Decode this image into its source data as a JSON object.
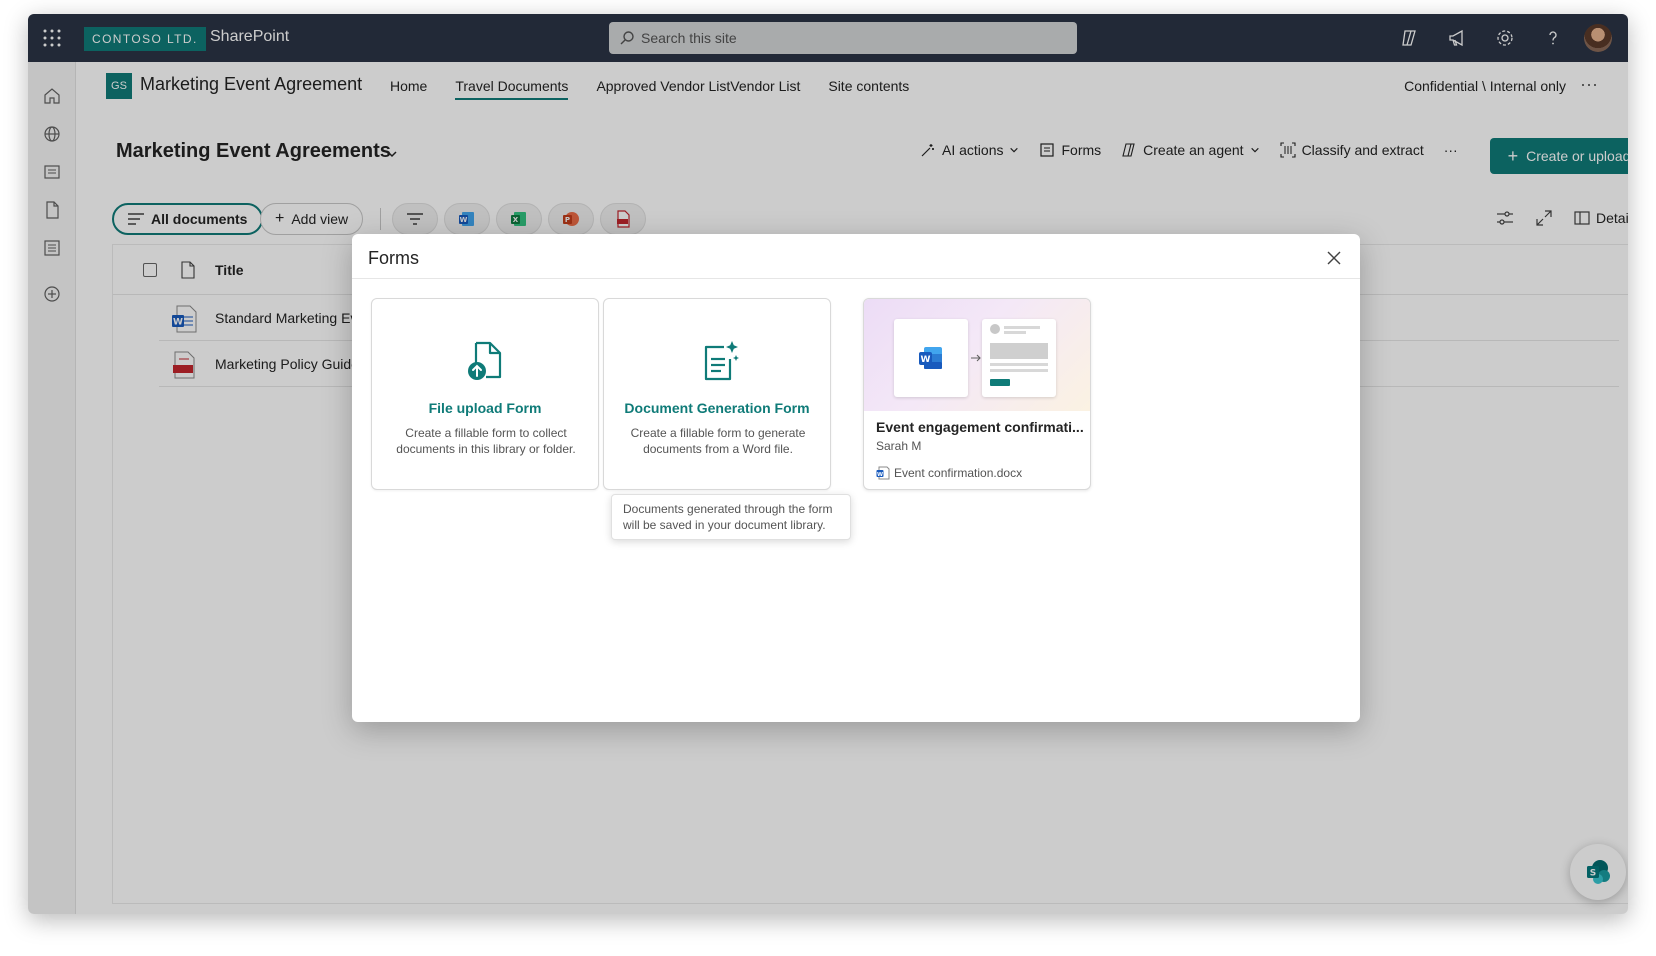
{
  "topbar": {
    "brand": "CONTOSO LTD.",
    "app": "SharePoint",
    "search_placeholder": "Search this site",
    "icons": [
      "waffle-icon",
      "copilot-icon",
      "megaphone-icon",
      "gear-icon",
      "help-icon",
      "avatar"
    ]
  },
  "site": {
    "logo_initials": "GS",
    "title": "Marketing Event Agreement",
    "nav": [
      "Home",
      "Travel Documents",
      "Approved Vendor ListVendor List",
      "Site contents"
    ],
    "active_nav": "Travel Documents",
    "label": "Confidential \\ Internal only",
    "more": "···"
  },
  "library": {
    "title": "Marketing Event Agreements",
    "commands": {
      "ai": "AI actions",
      "forms": "Forms",
      "agent": "Create an agent",
      "classify": "Classify and extract",
      "more": "···"
    },
    "create": "Create or upload",
    "views": {
      "all": "All documents",
      "add": "Add view"
    },
    "details": "Details"
  },
  "list": {
    "column_title": "Title",
    "rows": [
      {
        "name": "Standard Marketing Ev",
        "type": "word"
      },
      {
        "name": "Marketing Policy Guide",
        "type": "pdf"
      }
    ]
  },
  "dialog": {
    "title": "Forms",
    "cards": [
      {
        "title": "File upload Form",
        "desc": "Create a fillable form to collect documents in this library or folder."
      },
      {
        "title": "Document Generation Form",
        "desc": "Create a fillable form to generate documents from a Word file."
      }
    ],
    "template": {
      "title": "Event engagement confirmati...",
      "author": "Sarah M",
      "file": "Event confirmation.docx"
    },
    "tooltip": "Documents generated through the form will be saved in your document library."
  },
  "colors": {
    "accent": "#0f7b78",
    "topbar": "#2b3445",
    "word": "#185abd",
    "excel": "#107c41",
    "ppt": "#c43e1c",
    "pdf": "#c4262e"
  }
}
